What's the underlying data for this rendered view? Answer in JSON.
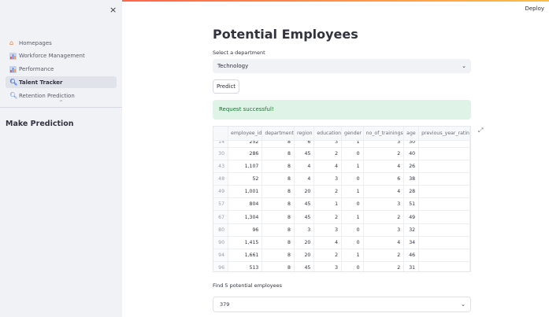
{
  "header": {
    "deploy_label": "Deploy"
  },
  "sidebar": {
    "close_icon": "×",
    "items": [
      {
        "label": "Homepages",
        "icon": "house-icon",
        "active": false
      },
      {
        "label": "Workforce Management",
        "icon": "bar-chart-icon",
        "active": false
      },
      {
        "label": "Performance",
        "icon": "bar-chart-icon",
        "active": false
      },
      {
        "label": "Talent Tracker",
        "icon": "search-icon",
        "active": true
      },
      {
        "label": "Retention Prediction",
        "icon": "search-icon",
        "active": false
      }
    ],
    "section_title": "Make Prediction"
  },
  "main": {
    "title": "Potential Employees",
    "select_label": "Select a department",
    "select_value": "Technology",
    "predict_label": "Predict",
    "success_message": "Request successful!",
    "find_label": "Find 5 potential employees",
    "find_value": "379"
  },
  "table": {
    "columns": [
      "",
      "employee_id",
      "department",
      "region",
      "education",
      "gender",
      "no_of_trainings",
      "age",
      "previous_year_ratin"
    ],
    "rows": [
      [
        "14",
        "252",
        "8",
        "6",
        "3",
        "1",
        "3",
        "30",
        ""
      ],
      [
        "30",
        "286",
        "8",
        "45",
        "2",
        "0",
        "2",
        "40",
        ""
      ],
      [
        "43",
        "1,107",
        "8",
        "4",
        "4",
        "1",
        "4",
        "26",
        ""
      ],
      [
        "48",
        "52",
        "8",
        "4",
        "3",
        "0",
        "6",
        "38",
        ""
      ],
      [
        "49",
        "1,001",
        "8",
        "20",
        "2",
        "1",
        "4",
        "28",
        ""
      ],
      [
        "57",
        "804",
        "8",
        "45",
        "1",
        "0",
        "3",
        "51",
        ""
      ],
      [
        "67",
        "1,304",
        "8",
        "45",
        "2",
        "1",
        "2",
        "49",
        ""
      ],
      [
        "80",
        "96",
        "8",
        "3",
        "3",
        "0",
        "3",
        "32",
        ""
      ],
      [
        "90",
        "1,415",
        "8",
        "20",
        "4",
        "0",
        "4",
        "34",
        ""
      ],
      [
        "94",
        "1,661",
        "8",
        "20",
        "2",
        "1",
        "2",
        "46",
        ""
      ],
      [
        "96",
        "513",
        "8",
        "45",
        "3",
        "0",
        "2",
        "31",
        ""
      ]
    ]
  },
  "colors": {
    "accent_start": "#ff4b4b",
    "accent_end": "#ffbd45",
    "success_bg": "#dff4e6",
    "success_text": "#177233",
    "sidebar_bg": "#f0f2f6"
  }
}
